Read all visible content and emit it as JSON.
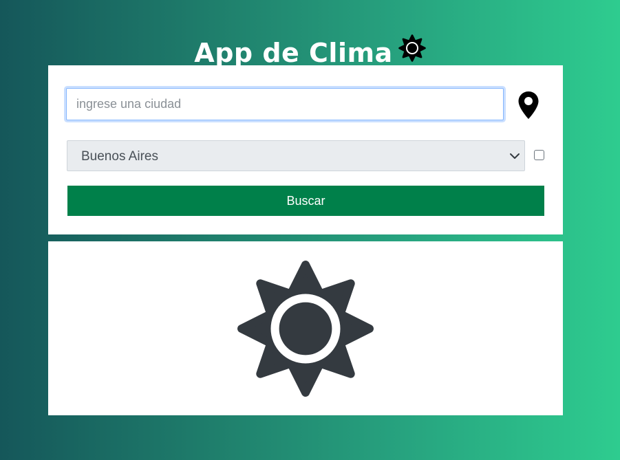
{
  "header": {
    "title": "App de Clima",
    "title_icon": "sun-icon"
  },
  "form": {
    "city_input": {
      "placeholder": "ingrese una ciudad",
      "value": ""
    },
    "location_icon": "map-pin-icon",
    "city_select": {
      "selected": "Buenos Aires"
    },
    "checkbox_checked": false,
    "search_label": "Buscar"
  },
  "result": {
    "weather_icon": "sun-icon"
  },
  "colors": {
    "background_start": "#15575a",
    "background_end": "#2ecc8f",
    "button": "#00804a",
    "icon": "#343a40"
  }
}
